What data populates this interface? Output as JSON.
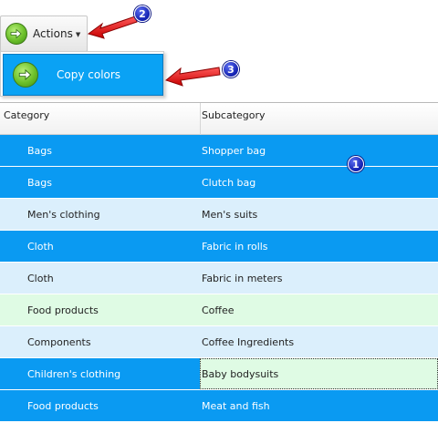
{
  "toolbar": {
    "actions_label": "Actions",
    "actions_icon": "green-arrow-icon"
  },
  "menu": {
    "items": [
      {
        "label": "Copy colors",
        "icon": "green-arrow-icon"
      }
    ]
  },
  "grid": {
    "columns": [
      "Category",
      "Subcategory"
    ],
    "rows": [
      {
        "category": "Bags",
        "subcategory": "Shopper bag",
        "style": "blue"
      },
      {
        "category": "Bags",
        "subcategory": "Clutch bag",
        "style": "blue"
      },
      {
        "category": "Men's clothing",
        "subcategory": "Men's suits",
        "style": "light"
      },
      {
        "category": "Cloth",
        "subcategory": "Fabric in rolls",
        "style": "blue"
      },
      {
        "category": "Cloth",
        "subcategory": "Fabric in meters",
        "style": "light"
      },
      {
        "category": "Food products",
        "subcategory": "Coffee",
        "style": "green"
      },
      {
        "category": "Components",
        "subcategory": "Coffee Ingredients",
        "style": "light"
      },
      {
        "category": "Children's clothing",
        "subcategory": "Baby bodysuits",
        "style": "blue"
      },
      {
        "category": "Food products",
        "subcategory": "Meat and fish",
        "style": "blue"
      }
    ]
  },
  "annotations": {
    "badges": [
      "1",
      "2",
      "3"
    ]
  },
  "colors": {
    "row_blue": "#0a9af2",
    "row_light": "#dbeffc",
    "row_green": "#dffbe4",
    "menu_highlight": "#0aa2f4",
    "arrow_red": "#e00000",
    "badge_blue": "#1220b0"
  }
}
